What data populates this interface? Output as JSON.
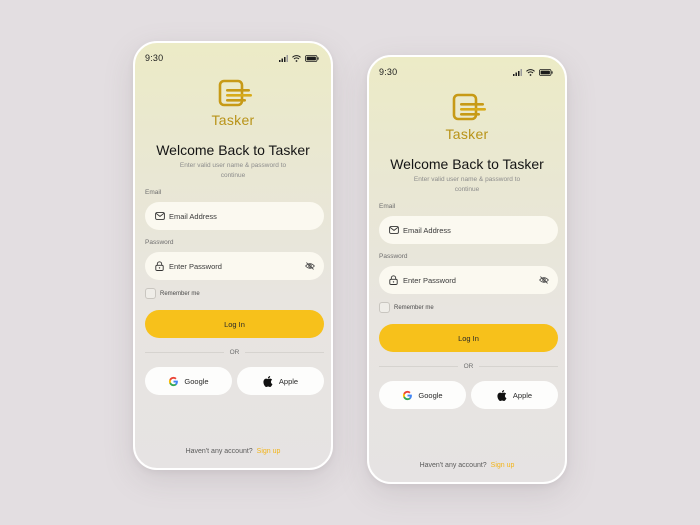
{
  "screens": [
    {
      "status": {
        "time": "9:30"
      },
      "brand": "Tasker",
      "title": "Welcome Back to Tasker",
      "subtitle": "Enter valid user name & password to continue",
      "email": {
        "label": "Email",
        "placeholder": "Email Address",
        "icon": "mail-icon"
      },
      "password": {
        "label": "Password",
        "placeholder": "Enter Password",
        "icon": "lock-icon",
        "toggle_icon": "eye-off-icon"
      },
      "remember_label": "Remember me",
      "login_label": "Log In",
      "or_label": "OR",
      "google_label": "Google",
      "apple_label": "Apple",
      "footer": {
        "text": "Haven't any account?",
        "link": "Sign up"
      }
    },
    {
      "status": {
        "time": "9:30"
      },
      "brand": "Tasker",
      "title": "Welcome Back to Tasker",
      "subtitle": "Enter valid user name & password to continue",
      "email": {
        "label": "Email",
        "placeholder": "Email Address",
        "icon": "mail-icon"
      },
      "password": {
        "label": "Password",
        "placeholder": "Enter Password",
        "icon": "lock-icon",
        "toggle_icon": "eye-off-icon"
      },
      "remember_label": "Remember me",
      "login_label": "Log In",
      "or_label": "OR",
      "google_label": "Google",
      "apple_label": "Apple",
      "footer": {
        "text": "Haven't any account?",
        "link": "Sign up"
      }
    }
  ],
  "colors": {
    "background": "#e3dee1",
    "accent": "#f7c11b",
    "brand": "#b89318",
    "link": "#f2b41a"
  }
}
